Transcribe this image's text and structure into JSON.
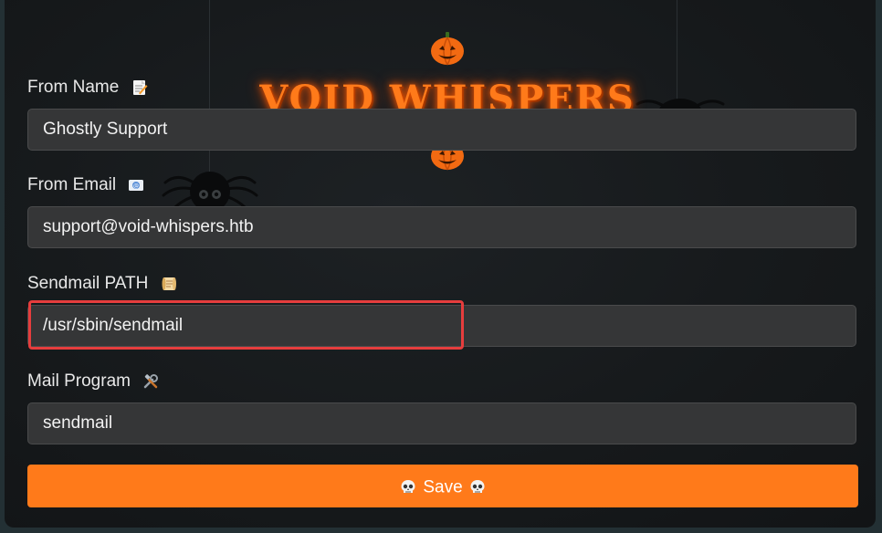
{
  "title": "VOID WHISPERS",
  "colors": {
    "accent": "#ff7a1a",
    "background": "#16191b",
    "field_bg": "#353637",
    "highlight": "#e63d3d",
    "text": "#e8e8e8"
  },
  "form": {
    "from_name": {
      "label": "From Name",
      "icon": "memo-icon",
      "value": "Ghostly Support"
    },
    "from_email": {
      "label": "From Email",
      "icon": "envelope-icon",
      "value": "support@void-whispers.htb"
    },
    "sendmail_path": {
      "label": "Sendmail PATH",
      "icon": "scroll-icon",
      "value": "/usr/sbin/sendmail"
    },
    "mail_program": {
      "label": "Mail Program",
      "icon": "tools-icon",
      "value": "sendmail"
    },
    "save_button": {
      "label": "Save",
      "icon": "skull-icon"
    }
  }
}
